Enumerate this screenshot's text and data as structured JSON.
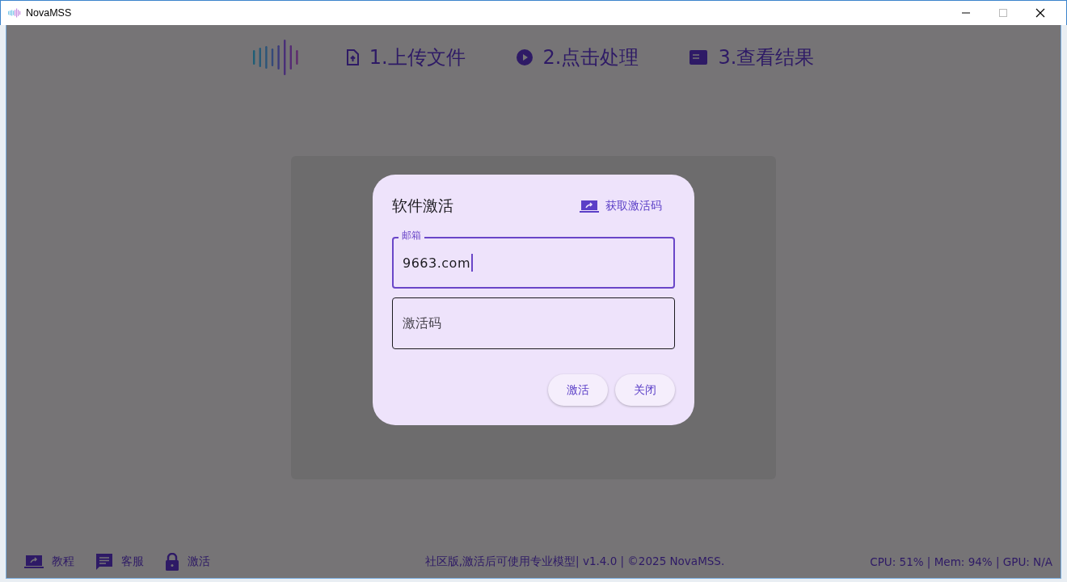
{
  "window": {
    "title": "NovaMSS"
  },
  "steps": [
    {
      "label": "1.上传文件",
      "kind": "upload"
    },
    {
      "label": "2.点击处理",
      "kind": "play"
    },
    {
      "label": "3.查看结果",
      "kind": "card"
    }
  ],
  "dialog": {
    "title": "软件激活",
    "get_code_link": "获取激活码",
    "fields": [
      {
        "label": "邮箱",
        "value": "9663.com",
        "focused": true
      },
      {
        "placeholder": "激活码",
        "focused": false
      }
    ],
    "buttons": [
      "激活",
      "关闭"
    ]
  },
  "footer": {
    "links": [
      {
        "label": "教程",
        "kind": "laptop"
      },
      {
        "label": "客服",
        "kind": "chat"
      },
      {
        "label": "激活",
        "kind": "lock"
      }
    ],
    "info": "社区版,激活后可使用专业模型| v1.4.0 | ©2025 NovaMSS.",
    "stats": "CPU: 51% | Mem: 94% | GPU: N/A"
  }
}
